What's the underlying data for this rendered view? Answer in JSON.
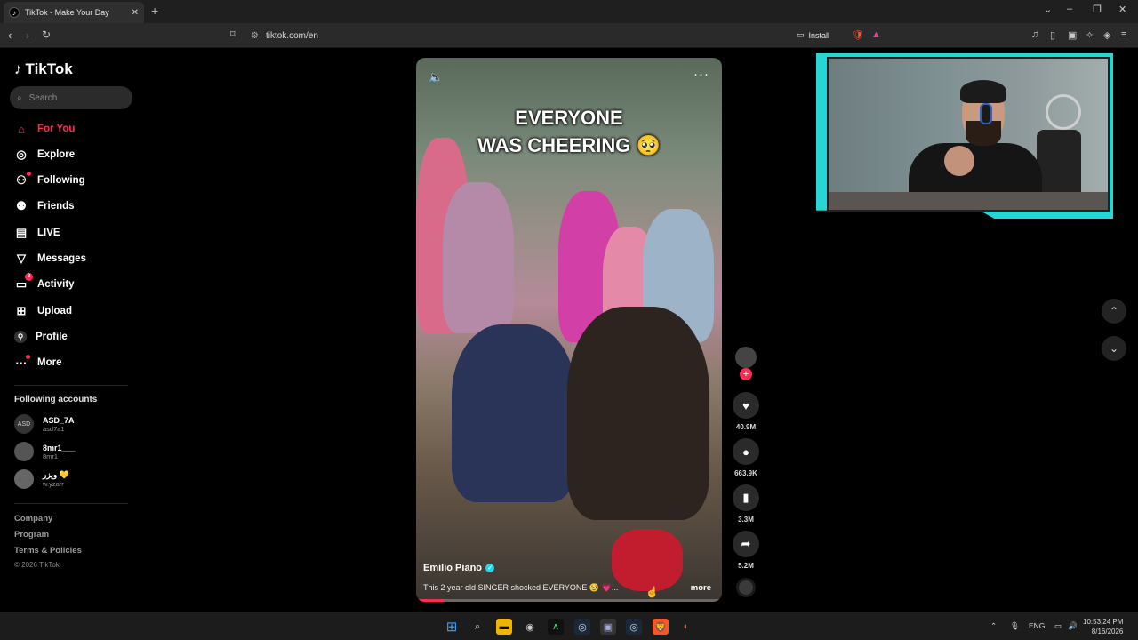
{
  "browser": {
    "tab_title": "TikTok - Make Your Day",
    "url": "tiktok.com/en",
    "install_label": "Install",
    "ext_badge": "6"
  },
  "sidebar": {
    "logo_text": "TikTok",
    "search_placeholder": "Search",
    "nav": [
      {
        "label": "For You",
        "icon": "home-icon"
      },
      {
        "label": "Explore",
        "icon": "compass-icon"
      },
      {
        "label": "Following",
        "icon": "following-icon"
      },
      {
        "label": "Friends",
        "icon": "friends-icon"
      },
      {
        "label": "LIVE",
        "icon": "live-icon"
      },
      {
        "label": "Messages",
        "icon": "messages-icon"
      },
      {
        "label": "Activity",
        "icon": "activity-icon",
        "badge": "2"
      },
      {
        "label": "Upload",
        "icon": "upload-icon"
      },
      {
        "label": "Profile",
        "icon": "profile-icon"
      },
      {
        "label": "More",
        "icon": "more-icon"
      }
    ],
    "following_title": "Following accounts",
    "accounts": [
      {
        "name": "ASD_7A",
        "handle": "asd7a1",
        "avatar_text": "ASD"
      },
      {
        "name": "8mr1___",
        "handle": "8mr1___",
        "avatar_text": ""
      },
      {
        "name": "ويزر 💛",
        "handle": "w.yzarr",
        "avatar_text": ""
      }
    ],
    "footer": [
      "Company",
      "Program",
      "Terms & Policies"
    ],
    "copyright": "© 2026 TikTok"
  },
  "video": {
    "caption_line1": "EVERYONE",
    "caption_line2": "WAS CHEERING 🥺",
    "author": "Emilio Piano",
    "description": "This 2 year old SINGER shocked EVERYONE 🥹 💗...",
    "more_label": "more",
    "progress": 0.09,
    "likes": "40.9M",
    "comments": "663.9K",
    "saves": "3.3M",
    "shares": "5.2M"
  },
  "taskbar": {
    "lang": "ENG",
    "time": "10:53:24 PM",
    "date": "8/16/2026"
  },
  "colors": {
    "accent": "#fe2c55",
    "webcam_frame": "#28d5d5"
  }
}
